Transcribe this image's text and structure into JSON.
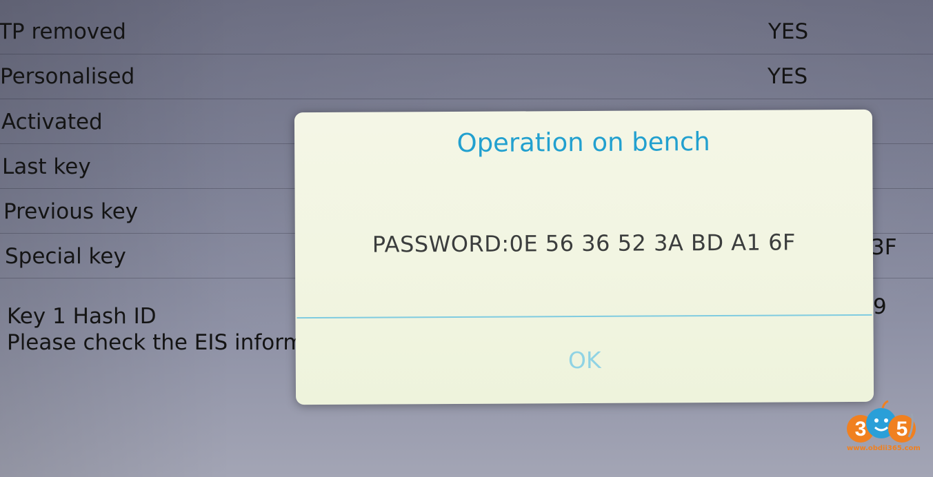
{
  "rows": [
    {
      "label": "TP removed",
      "value": "YES"
    },
    {
      "label": "Personalised",
      "value": "YES"
    },
    {
      "label": "Activated",
      "value": ""
    },
    {
      "label": "Last key",
      "value": ""
    },
    {
      "label": "Previous key",
      "value": ""
    },
    {
      "label": "Special key",
      "value": "3F"
    }
  ],
  "info": {
    "hash_label": "Key 1 Hash ID",
    "hash_value": "9",
    "notice": "Please check the EIS inform"
  },
  "dialog": {
    "title": "Operation on bench",
    "message": "PASSWORD:0E 56 36 52 3A BD A1 6F",
    "ok_label": "OK"
  },
  "watermark": {
    "text": "365",
    "url": "www.obdii365.com"
  },
  "colors": {
    "dialog_title": "#22a0cf",
    "divider": "#7ecbe0",
    "ok_text": "#8fd3e4",
    "watermark": "#f08020"
  }
}
